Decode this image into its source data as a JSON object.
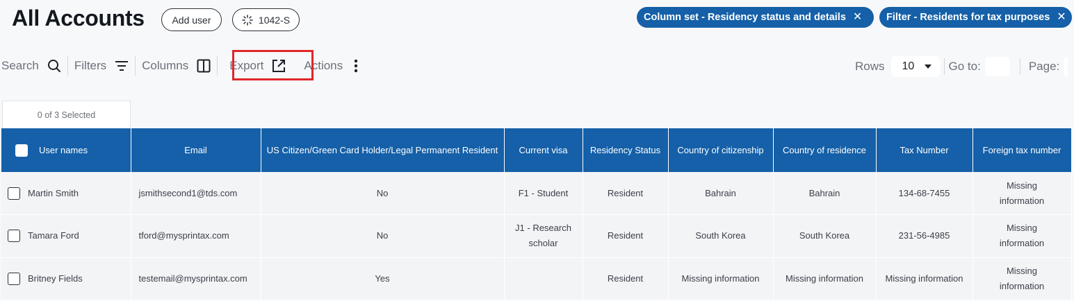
{
  "header": {
    "title": "All Accounts",
    "add_user_label": "Add user",
    "form_1042_label": "1042-S"
  },
  "chips": [
    {
      "label": "Column set - Residency status and details",
      "close": "✕"
    },
    {
      "label": "Filter - Residents for tax purposes",
      "close": "✕"
    }
  ],
  "toolbar": {
    "search": "Search",
    "filters": "Filters",
    "columns": "Columns",
    "export": "Export",
    "actions": "Actions",
    "rows_label": "Rows",
    "rows_value": "10",
    "goto_label": "Go to:",
    "page_label": "Page:"
  },
  "selection": {
    "text": "0 of 3 Selected"
  },
  "table": {
    "headers": [
      "User names",
      "Email",
      "US Citizen/Green Card Holder/Legal Permanent Resident",
      "Current visa",
      "Residency Status",
      "Country of citizenship",
      "Country of residence",
      "Tax Number",
      "Foreign tax number"
    ],
    "rows": [
      [
        "Martin Smith",
        "jsmithsecond1@tds.com",
        "No",
        "F1 - Student",
        "Resident",
        "Bahrain",
        "Bahrain",
        "134-68-7455",
        "Missing information"
      ],
      [
        "Tamara Ford",
        "tford@mysprintax.com",
        "No",
        "J1 - Research scholar",
        "Resident",
        "South Korea",
        "South Korea",
        "231-56-4985",
        "Missing information"
      ],
      [
        "Britney Fields",
        "testemail@mysprintax.com",
        "Yes",
        "",
        "Resident",
        "Missing information",
        "Missing information",
        "Missing information",
        "Missing information"
      ]
    ]
  },
  "colors": {
    "accent": "#1560a8",
    "highlight": "#e0262b"
  }
}
